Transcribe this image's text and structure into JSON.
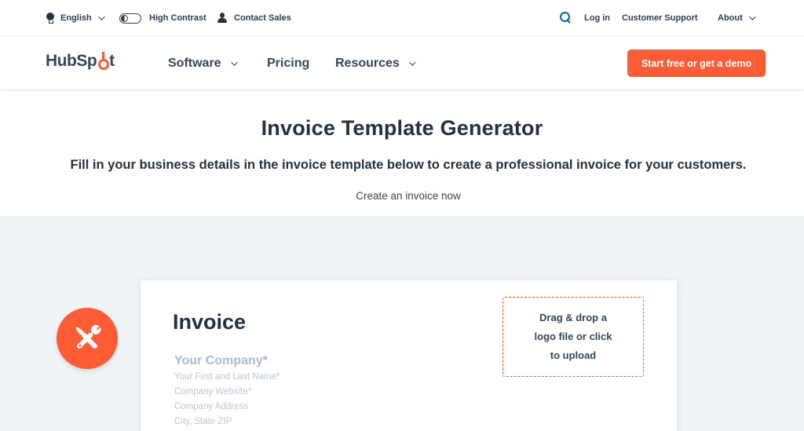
{
  "utility_bar": {
    "language": {
      "label": "English",
      "icon": "globe-icon"
    },
    "high_contrast": {
      "label": "High Contrast",
      "icon": "contrast-toggle-icon"
    },
    "contact_sales": {
      "label": "Contact Sales",
      "icon": "person-icon"
    },
    "search": {
      "icon": "search-icon"
    },
    "login": "Log in",
    "customer_support": "Customer Support",
    "about": {
      "label": "About"
    }
  },
  "main_nav": {
    "logo": {
      "text_before": "HubSp",
      "text_after": "t"
    },
    "items": [
      {
        "label": "Software",
        "has_dropdown": true
      },
      {
        "label": "Pricing",
        "has_dropdown": false
      },
      {
        "label": "Resources",
        "has_dropdown": true
      }
    ],
    "cta_label": "Start free or get a demo"
  },
  "hero": {
    "title": "Invoice Template Generator",
    "subtitle": "Fill in your business details in the invoice template below to create a professional invoice for your customers.",
    "link": "Create an invoice now"
  },
  "invoice": {
    "badge_icon": "tools-icon",
    "title": "Invoice",
    "fields": {
      "company": "Your Company*",
      "name": "Your First and Last Name*",
      "website": "Company Website*",
      "address": "Company Address",
      "city": "City, State ZIP"
    },
    "logo_upload": "Drag & drop a logo file or click to upload"
  },
  "colors": {
    "brand_orange": "#ff5c35",
    "text_dark": "#213343",
    "link_blue": "#0068b1",
    "section_gray": "#f1f4f7",
    "placeholder": "#b8c7d6"
  }
}
